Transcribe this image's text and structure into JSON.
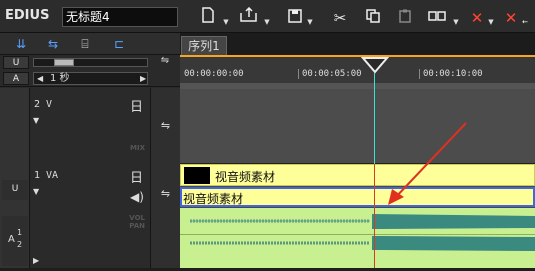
{
  "app": {
    "name": "EDIUS",
    "project_title": "无标题4"
  },
  "sequence": {
    "tab_label": "序列1"
  },
  "timecodes": [
    "00:00:00:00",
    "00:00:05:00",
    "00:00:10:00"
  ],
  "scale": {
    "value": "1 秒"
  },
  "tracks": [
    {
      "id": "2 V",
      "extra": "MIX"
    },
    {
      "id": "1 VA",
      "extra1": "VOL",
      "extra2": "PAN"
    }
  ],
  "clips": {
    "video_label": "视音频素材",
    "audio_label": "视音频素材"
  },
  "side_labels": {
    "u1": "U",
    "a1": "A",
    "u2": "U",
    "a12": "A",
    "sub1": "1",
    "sub2": "2"
  },
  "colors": {
    "timeline_accent": "#f5a623",
    "playhead": "#40e0d0",
    "clip_yellow": "#ffff88",
    "clip_audio_green": "#c8f090",
    "arrow_red": "#e03020"
  }
}
